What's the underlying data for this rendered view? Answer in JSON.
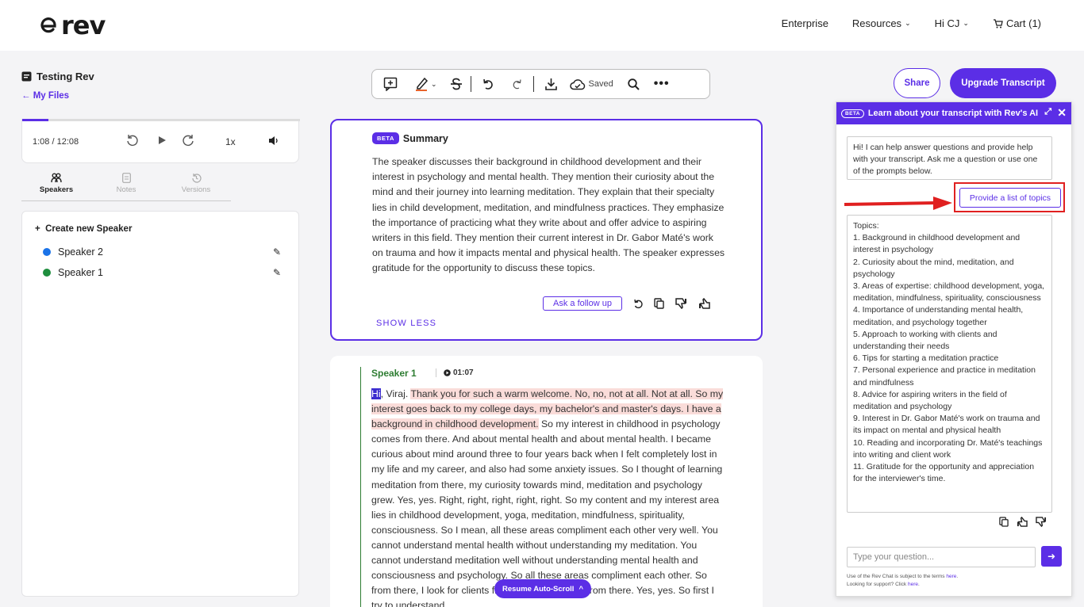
{
  "header": {
    "logo_text": "rev",
    "nav": {
      "enterprise": "Enterprise",
      "resources": "Resources",
      "user": "Hi CJ",
      "cart": "Cart (1)"
    }
  },
  "file": {
    "title": "Testing Rev",
    "back": "← My Files"
  },
  "player": {
    "time": "1:08 / 12:08",
    "speed": "1x",
    "progress": 0.093
  },
  "left_tabs": [
    {
      "label": "Speakers"
    },
    {
      "label": "Notes"
    },
    {
      "label": "Versions"
    }
  ],
  "speakers": {
    "create": "Create new Speaker",
    "list": [
      {
        "name": "Speaker 2",
        "color": "#1a73e8"
      },
      {
        "name": "Speaker 1",
        "color": "#1e8e3e"
      }
    ]
  },
  "toolbar": {
    "saved": "Saved"
  },
  "summary": {
    "badge": "BETA",
    "title": "Summary",
    "text": "The speaker discusses their background in childhood development and their interest in psychology and mental health. They mention their curiosity about the mind and their journey into learning meditation. They explain that their specialty lies in child development, meditation, and mindfulness practices. They emphasize the importance of practicing what they write about and offer advice to aspiring writers in this field. They mention their current interest in Dr. Gabor Maté's work on trauma and how it impacts mental and physical health. The speaker expresses gratitude for the opportunity to discuss these topics.",
    "follow_up": "Ask a follow up",
    "show_less": "SHOW LESS"
  },
  "transcript": {
    "speaker": "Speaker 1",
    "timestamp": "01:07",
    "selected_word": "Hi",
    "after_selected": ", Viraj. ",
    "highlighted": "Thank you for such a warm welcome. No, no, not at all. Not at all. So my interest goes back to my college days, my bachelor's and master's days. I have a background in childhood development.",
    "rest": " So my interest in childhood in psychology comes from there. And about mental health and about mental health. I became curious about mind around three to four years back when I felt completely lost in my life and my career, and also had some anxiety issues. So I thought of learning meditation from there, my curiosity towards mind, meditation and psychology grew. Yes, yes. Right, right, right, right, right. So my content and my interest area lies in childhood development, yoga, meditation, mindfulness, spirituality, consciousness. So I mean, all these areas compliment each other very well. You cannot understand mental health without understanding my meditation. You cannot understand meditation well without understanding mental health and consciousness and psychology. So all these areas compliment each other. So from there, I look for clients from these areas and from there. Yes, yes. So first I try to understand"
  },
  "resume_button": "Resume Auto-Scroll",
  "actions": {
    "share": "Share",
    "upgrade": "Upgrade Transcript"
  },
  "ai": {
    "badge": "BETA",
    "title": "Learn about your transcript with Rev's AI",
    "greeting": "Hi! I can help answer questions and provide help with your transcript. Ask me a question or use one of the prompts below.",
    "prompt": "Provide a list of topics",
    "response_title": "Topics:",
    "topics": [
      "1. Background in childhood development and interest in psychology",
      "2. Curiosity about the mind, meditation, and psychology",
      "3. Areas of expertise: childhood development, yoga, meditation, mindfulness, spirituality, consciousness",
      "4. Importance of understanding mental health, meditation, and psychology together",
      "5. Approach to working with clients and understanding their needs",
      "6. Tips for starting a meditation practice",
      "7. Personal experience and practice in meditation and mindfulness",
      "8. Advice for aspiring writers in the field of meditation and psychology",
      "9. Interest in Dr. Gabor Maté's work on trauma and its impact on mental and physical health",
      "10. Reading and incorporating Dr. Maté's teachings into writing and client work",
      "11. Gratitude for the opportunity and appreciation for the interviewer's time."
    ],
    "input_placeholder": "Type your question...",
    "fine_print_1": "Use of the Rev Chat is subject to the terms ",
    "fine_print_link1": "here",
    "fine_print_2": "Looking for support? Click ",
    "fine_print_link2": "here"
  }
}
